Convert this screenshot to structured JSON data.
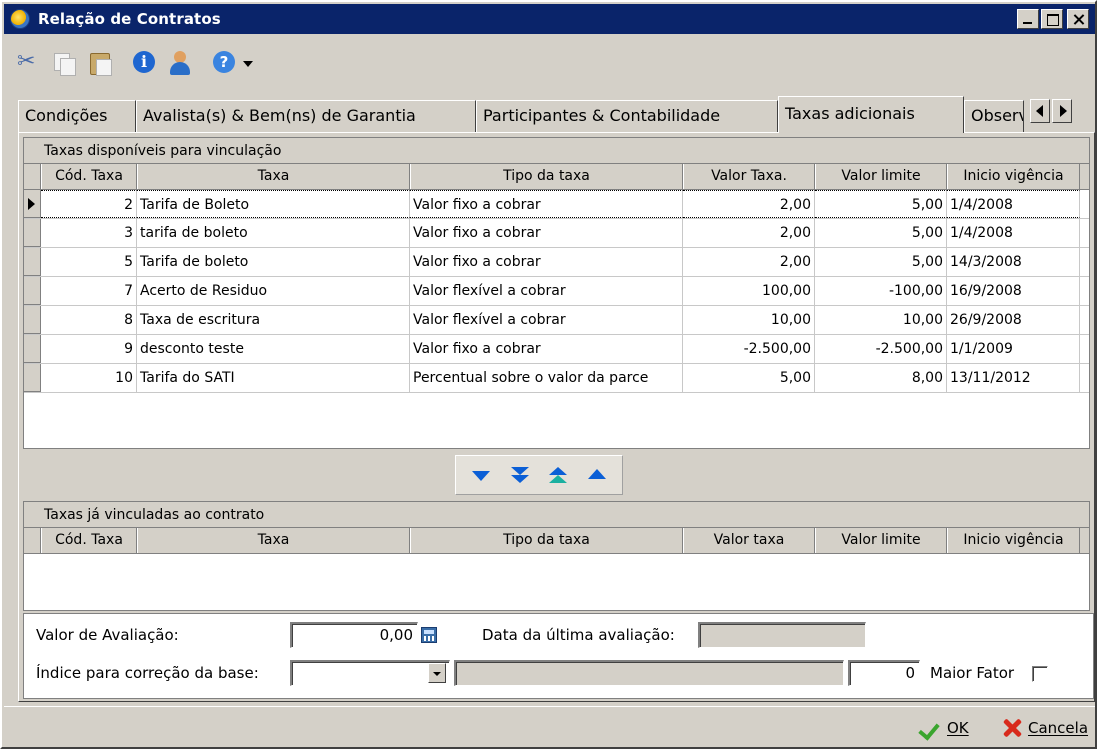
{
  "window": {
    "title": "Relação de Contratos"
  },
  "toolbar": {
    "icons": [
      "cut-icon",
      "copy-icon",
      "paste-icon",
      "info-icon",
      "user-icon",
      "help-icon",
      "dropdown-arrow-icon"
    ]
  },
  "tabs": [
    {
      "label": "Condições",
      "active": false
    },
    {
      "label": "Avalista(s) & Bem(ns) de Garantia",
      "active": false
    },
    {
      "label": "Participantes & Contabilidade",
      "active": false
    },
    {
      "label": "Taxas adicionais",
      "active": true
    },
    {
      "label": "Observ",
      "active": false
    }
  ],
  "available_grid": {
    "caption": "Taxas disponíveis para vinculação",
    "columns": [
      "Cód. Taxa",
      "Taxa",
      "Tipo da taxa",
      "Valor Taxa.",
      "Valor limite",
      "Inicio vigência"
    ],
    "rows": [
      {
        "cod": "2",
        "taxa": "Tarifa de Boleto",
        "tipo": "Valor fixo a cobrar",
        "valor": "2,00",
        "limite": "5,00",
        "inicio": "1/4/2008"
      },
      {
        "cod": "3",
        "taxa": "tarifa de boleto",
        "tipo": "Valor fixo a cobrar",
        "valor": "2,00",
        "limite": "5,00",
        "inicio": "1/4/2008"
      },
      {
        "cod": "5",
        "taxa": "Tarifa de boleto",
        "tipo": "Valor fixo a cobrar",
        "valor": "2,00",
        "limite": "5,00",
        "inicio": "14/3/2008"
      },
      {
        "cod": "7",
        "taxa": "Acerto de Residuo",
        "tipo": "Valor flexível a cobrar",
        "valor": "100,00",
        "limite": "-100,00",
        "inicio": "16/9/2008"
      },
      {
        "cod": "8",
        "taxa": "Taxa de escritura",
        "tipo": "Valor flexível a cobrar",
        "valor": "10,00",
        "limite": "10,00",
        "inicio": "26/9/2008"
      },
      {
        "cod": "9",
        "taxa": "desconto teste",
        "tipo": "Valor fixo a cobrar",
        "valor": "-2.500,00",
        "limite": "-2.500,00",
        "inicio": "1/1/2009"
      },
      {
        "cod": "10",
        "taxa": "Tarifa do SATI",
        "tipo": "Percentual sobre o valor da parce",
        "valor": "5,00",
        "limite": "8,00",
        "inicio": "13/11/2012"
      }
    ]
  },
  "linked_grid": {
    "caption": "Taxas já vinculadas ao contrato",
    "columns": [
      "Cód. Taxa",
      "Taxa",
      "Tipo da taxa",
      "Valor taxa",
      "Valor limite",
      "Inicio vigência"
    ],
    "rows": []
  },
  "form": {
    "valor_avaliacao_label": "Valor de Avaliação:",
    "valor_avaliacao_value": "0,00",
    "data_ultima_avaliacao_label": "Data da última avaliação:",
    "data_ultima_avaliacao_value": "",
    "indice_label": "Índice para correção da base:",
    "indice_value": "",
    "indice_descricao": "",
    "fator_value": "0",
    "maior_fator_label": "Maior Fator",
    "maior_fator_checked": false
  },
  "footer": {
    "ok_label": "OK",
    "cancel_label": "Cancela"
  }
}
